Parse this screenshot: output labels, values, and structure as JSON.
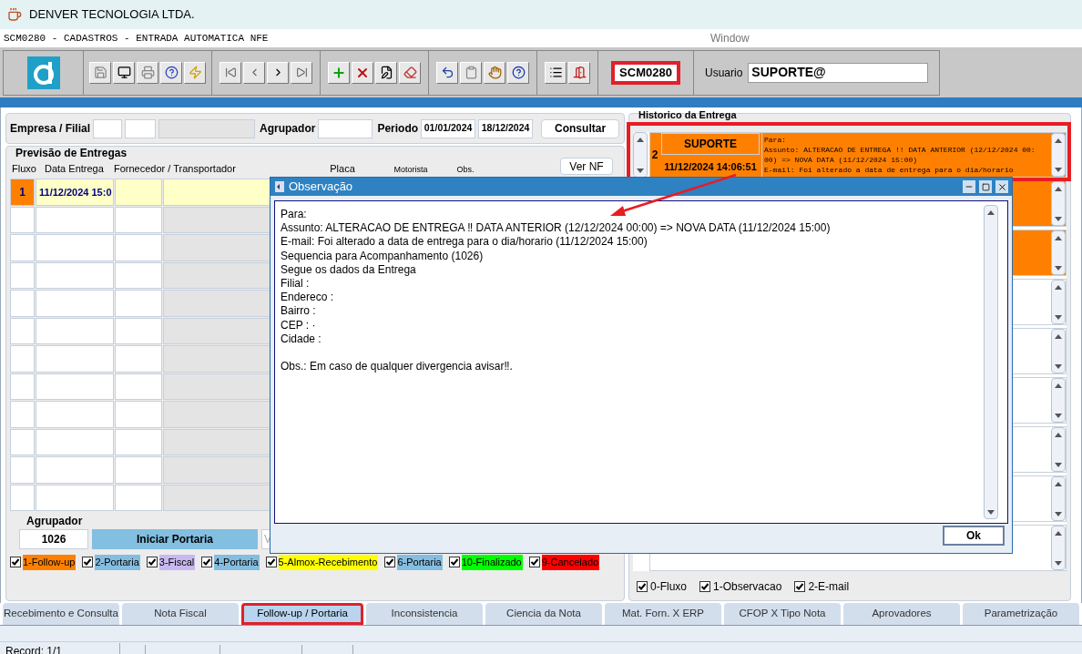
{
  "app_title": "DENVER TECNOLOGIA LTDA.",
  "form_title": "SCM0280 - CADASTROS - ENTRADA AUTOMATICA NFE",
  "menu": [
    "Window"
  ],
  "toolbar": {
    "form_code": "SCM0280",
    "user_label": "Usuario",
    "user": "SUPORTE@"
  },
  "filters": {
    "empresa_label": "Empresa / Filial",
    "agrupador_label": "Agrupador",
    "periodo_label": "Periodo",
    "date_from": "01/01/2024",
    "date_to": "18/12/2024",
    "search_button": "Consultar"
  },
  "deliveries": {
    "title": "Previsão de Entregas",
    "columns": [
      "Fluxo",
      "Data Entrega",
      "Fornecedor / Transportador",
      "Placa",
      "Motorista",
      "Obs."
    ],
    "view_button": "Ver NF",
    "rows": [
      {
        "fluxo": "1",
        "date": "11/12/2024 15:0",
        "color": "#ff8000"
      }
    ]
  },
  "agrupador": {
    "label": "Agrupador",
    "value": "1026",
    "start_button": "Iniciar Portaria",
    "partial_button": "V"
  },
  "legend": [
    {
      "label": "1-Follow-up",
      "checked": true,
      "color": "#ff8000"
    },
    {
      "label": "2-Portaria",
      "checked": true,
      "color": "#84bde0"
    },
    {
      "label": "3-Fiscal",
      "checked": true,
      "color": "#c8b8f0"
    },
    {
      "label": "4-Portaria",
      "checked": true,
      "color": "#84bde0"
    },
    {
      "label": "5-Almox-Recebimento",
      "checked": true,
      "color": "#ffff00"
    },
    {
      "label": "6-Portaria",
      "checked": true,
      "color": "#84bde0"
    },
    {
      "label": "10-Finalizado",
      "checked": true,
      "color": "#00ff00"
    },
    {
      "label": "9-Cancelado",
      "checked": true,
      "color": "#ff0000"
    }
  ],
  "history": {
    "title": "Historico da Entrega",
    "entry": {
      "number": "2",
      "user": "SUPORTE",
      "time": "11/12/2024 14:06:51",
      "lines": [
        "Para:",
        "Assunto: ALTERACAO DE ENTREGA !! DATA ANTERIOR (12/12/2024 00:",
        "00) => NOVA DATA (11/12/2024 15:00)",
        "E-mail: Foi alterado a data de entrega para o dia/horario"
      ]
    },
    "more_rows": [
      {
        "highlighted": true
      },
      {
        "highlighted": true
      },
      {
        "highlighted": false
      },
      {
        "highlighted": false
      },
      {
        "highlighted": false
      },
      {
        "highlighted": false
      },
      {
        "highlighted": false
      },
      {
        "highlighted": false
      }
    ],
    "filters": [
      {
        "label": "0-Fluxo",
        "checked": true
      },
      {
        "label": "1-Observacao",
        "checked": true
      },
      {
        "label": "2-E-mail",
        "checked": true
      }
    ]
  },
  "dialog": {
    "title": "Observação",
    "paragraphs": [
      [
        "Para:",
        "Assunto: ALTERACAO DE ENTREGA ‼ DATA ANTERIOR (12/12/2024 00:00) => NOVA DATA (11/12/2024 15:00)",
        "E-mail: Foi alterado a data de entrega para o dia/horario (11/12/2024 15:00)",
        "Sequencia para Acompanhamento (1026)",
        "Segue os dados da Entrega",
        "Filial :",
        "Endereco :",
        "Bairro :",
        "CEP :  ·",
        "Cidade :"
      ],
      [
        "Obs.: Em caso de qualquer divergencia avisar‼."
      ]
    ],
    "ok_button": "Ok"
  },
  "tabs": [
    {
      "label": "Recebimento e Consulta",
      "selected": false
    },
    {
      "label": "Nota Fiscal",
      "selected": false
    },
    {
      "label": "Follow-up / Portaria",
      "selected": true
    },
    {
      "label": "Inconsistencia",
      "selected": false
    },
    {
      "label": "Ciencia da Nota",
      "selected": false
    },
    {
      "label": "Mat. Forn. X ERP",
      "selected": false
    },
    {
      "label": "CFOP X Tipo Nota",
      "selected": false
    },
    {
      "label": "Aprovadores",
      "selected": false
    },
    {
      "label": "Parametrização",
      "selected": false
    }
  ],
  "status_bar": {
    "record": "Record: 1/1"
  }
}
